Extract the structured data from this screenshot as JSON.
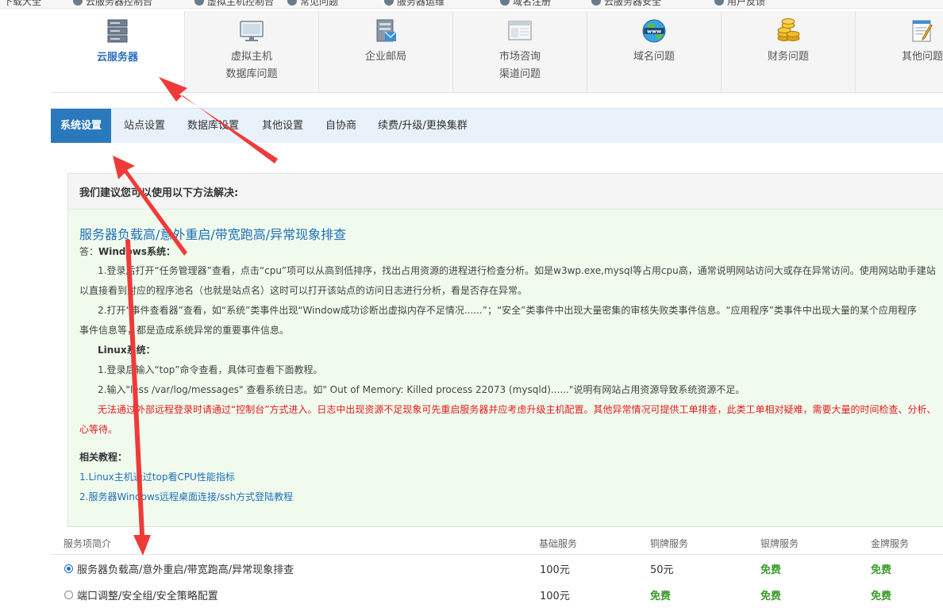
{
  "bookmarks": [
    {
      "label": "下载大全"
    },
    {
      "label": "云服务器控制台"
    },
    {
      "label": "虚拟主机控制台"
    },
    {
      "label": "常见问题"
    },
    {
      "label": "服务器运维"
    },
    {
      "label": "域名注册"
    },
    {
      "label": "云服务器安全"
    },
    {
      "label": "用户反馈"
    }
  ],
  "categories": [
    {
      "label1": "云服务器",
      "label2": "",
      "icon": "server-icon",
      "active": true
    },
    {
      "label1": "虚拟主机",
      "label2": "数据库问题",
      "icon": "monitor-icon",
      "active": false
    },
    {
      "label1": "企业邮局",
      "label2": "",
      "icon": "mail-server-icon",
      "active": false
    },
    {
      "label1": "市场咨询",
      "label2": "渠道问题",
      "icon": "browser-window-icon",
      "active": false
    },
    {
      "label1": "域名问题",
      "label2": "",
      "icon": "globe-www-icon",
      "active": false
    },
    {
      "label1": "财务问题",
      "label2": "",
      "icon": "coins-icon",
      "active": false
    },
    {
      "label1": "其他问题",
      "label2": "",
      "icon": "notepad-pencil-icon",
      "active": false
    }
  ],
  "tabs": [
    {
      "label": "系统设置",
      "active": true
    },
    {
      "label": "站点设置",
      "active": false
    },
    {
      "label": "数据库设置",
      "active": false
    },
    {
      "label": "其他设置",
      "active": false
    },
    {
      "label": "自协商",
      "active": false
    },
    {
      "label": "续费/升级/更换集群",
      "active": false
    }
  ],
  "panel": {
    "header": "我们建议您可以使用以下方法解决:",
    "title": "服务器负载高/意外重启/带宽跑高/异常现象排查",
    "answer_label": "答：",
    "windows_label": "Windows系统：",
    "win_step1_a": "1.登录后打开“任务管理器”查看，点击“cpu”项可以从高到低排序，找出占用资源的进程进行检查分析。如是w3wp.exe,mysql等占用cpu高，通常说明网站访问大或存在异常访问。使用网站助手建站",
    "win_step1_b": "以直接看到对应的程序池名（也就是站点名）这时可以打开该站点的访问日志进行分析，看是否存在异常。",
    "win_step2_a": "2.打开“事件查看器”查看，如“系统”类事件出现“Window成功诊断出虚拟内存不足情况......”；“安全”类事件中出现大量密集的审核失败类事件信息。“应用程序”类事件中出现大量的某个应用程序",
    "win_step2_b": "事件信息等，都是造成系统异常的重要事件信息。",
    "linux_label": "Linux系统：",
    "linux_step1": "1.登录后输入“top”命令查看，具体可查看下面教程。",
    "linux_step2": "2.输入\"less /var/log/messages\" 查看系统日志。如\" Out of Memory: Killed process 22073 (mysqld)......\"说明有网站占用资源导致系统资源不足。",
    "warning_a": "无法通过外部远程登录时请通过“控制台”方式进入。日志中出现资源不足现象可先重启服务器并应考虑升级主机配置。其他异常情况可提供工单排查，此类工单相对疑难，需要大量的时间检查、分析、",
    "warning_b": "心等待。",
    "tutorials_label": "相关教程：",
    "tutorial1": "1.Linux主机通过top看CPU性能指标",
    "tutorial2": "2.服务器Windows远程桌面连接/ssh方式登陆教程"
  },
  "services": {
    "headers": [
      "服务项简介",
      "基础服务",
      "铜牌服务",
      "银牌服务",
      "金牌服务"
    ],
    "rows": [
      {
        "name": "服务器负载高/意外重启/带宽跑高/异常现象排查",
        "basic": "100元",
        "bronze": "50元",
        "silver": "免费",
        "gold": "免费",
        "selected": true
      },
      {
        "name": "端口调整/安全组/安全策略配置",
        "basic": "100元",
        "bronze": "免费",
        "silver": "免费",
        "gold": "免费",
        "selected": false
      }
    ]
  },
  "colors": {
    "accent": "#2a79bd",
    "panel_bg": "#f0fbee",
    "warning": "#e21d1d",
    "free": "#3b9b2b",
    "annotation_arrow": "#f03a3a"
  }
}
